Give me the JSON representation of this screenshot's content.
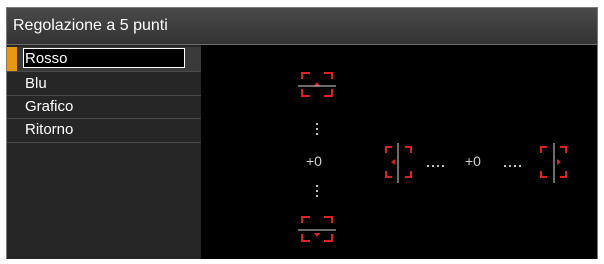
{
  "window": {
    "title": "Regolazione a 5 punti"
  },
  "menu": {
    "items": [
      {
        "label": "Rosso",
        "selected": true
      },
      {
        "label": "Blu"
      },
      {
        "label": "Grafico"
      },
      {
        "label": "Ritorno"
      }
    ]
  },
  "adjust": {
    "vertical_value": "+0",
    "horizontal_value": "+0",
    "point_color": "#e1201e"
  }
}
